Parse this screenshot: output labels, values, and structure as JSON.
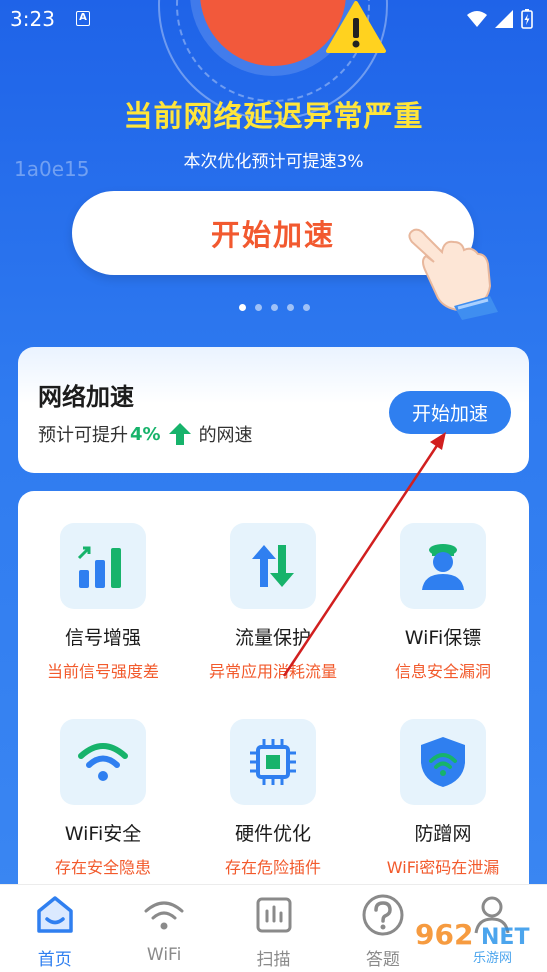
{
  "status_bar": {
    "time": "3:23",
    "notif_letter": "A"
  },
  "hero": {
    "headline": "当前网络延迟异常严重",
    "subline": "本次优化预计可提速3%",
    "watermark_id": "1a0e15",
    "start_button": "开始加速",
    "carousel_dots": 5,
    "carousel_active": 0
  },
  "accel_card": {
    "title": "网络加速",
    "sub_prefix": "预计可提升",
    "sub_pct": "4%",
    "sub_suffix": "的网速",
    "button": "开始加速"
  },
  "features": [
    {
      "title": "信号增强",
      "desc": "当前信号强度差",
      "icon": "signal-bars-icon"
    },
    {
      "title": "流量保护",
      "desc": "异常应用消耗流量",
      "icon": "up-down-arrows-icon"
    },
    {
      "title": "WiFi保镖",
      "desc": "信息安全漏洞",
      "icon": "guard-person-icon"
    },
    {
      "title": "WiFi安全",
      "desc": "存在安全隐患",
      "icon": "wifi-icon"
    },
    {
      "title": "硬件优化",
      "desc": "存在危险插件",
      "icon": "chip-icon"
    },
    {
      "title": "防蹭网",
      "desc": "WiFi密码在泄漏",
      "icon": "wifi-shield-icon"
    }
  ],
  "bottom_nav": [
    {
      "label": "首页",
      "icon": "home-icon",
      "active": true
    },
    {
      "label": "WiFi",
      "icon": "wifi-icon",
      "active": false
    },
    {
      "label": "扫描",
      "icon": "scan-icon",
      "active": false
    },
    {
      "label": "答题",
      "icon": "question-icon",
      "active": false
    },
    {
      "label": "",
      "icon": "user-icon",
      "active": false
    }
  ],
  "watermark_logo": {
    "brand_top": "962",
    "brand_net": "NET",
    "brand_bottom": "乐游网"
  },
  "colors": {
    "primary": "#2f7ff0",
    "warning_text": "#ffe53a",
    "accent_orange": "#f25a2c",
    "green": "#17b36b"
  }
}
